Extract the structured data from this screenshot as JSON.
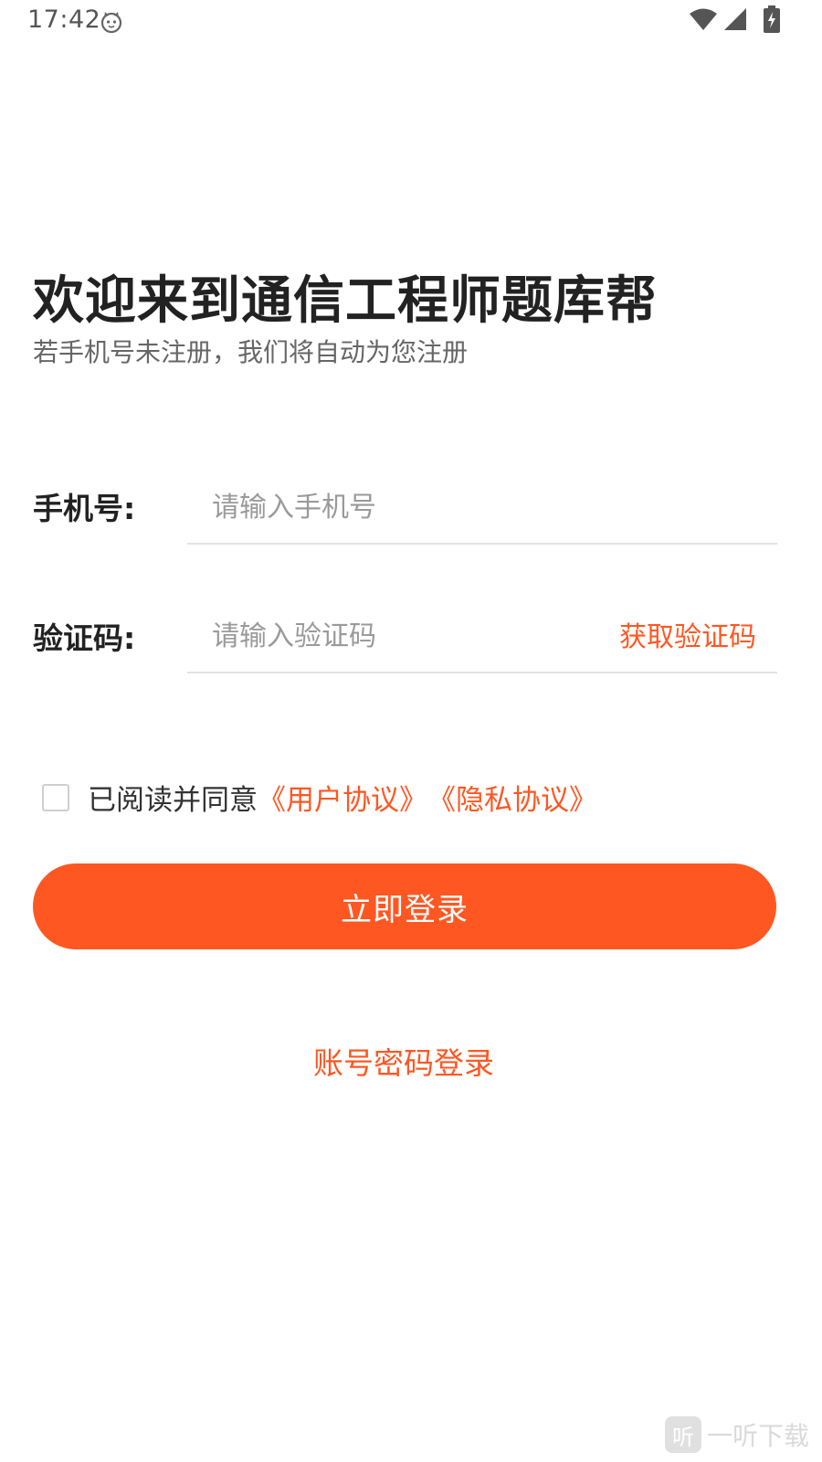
{
  "status_bar": {
    "time": "17:42",
    "icons": [
      "cat-face-icon",
      "wifi-icon",
      "cellular-signal-icon",
      "battery-charging-icon"
    ]
  },
  "welcome": {
    "title": "欢迎来到通信工程师题库帮",
    "subtitle": "若手机号未注册，我们将自动为您注册"
  },
  "form": {
    "phone_label": "手机号:",
    "phone_placeholder": "请输入手机号",
    "phone_value": "",
    "code_label": "验证码:",
    "code_placeholder": "请输入验证码",
    "code_value": "",
    "get_code_label": "获取验证码"
  },
  "agreement": {
    "checked": false,
    "prefix": "已阅读并同意",
    "user_agreement": "《用户协议》",
    "privacy_policy": "《隐私协议》"
  },
  "actions": {
    "login_label": "立即登录",
    "password_login_label": "账号密码登录"
  },
  "watermark": {
    "logo_char": "听",
    "text": "一听下载"
  },
  "colors": {
    "accent": "#ff5722",
    "title_text": "#222222",
    "subtitle_text": "#666666",
    "placeholder_text": "#9a9a9a",
    "divider": "#e3e3e3"
  }
}
